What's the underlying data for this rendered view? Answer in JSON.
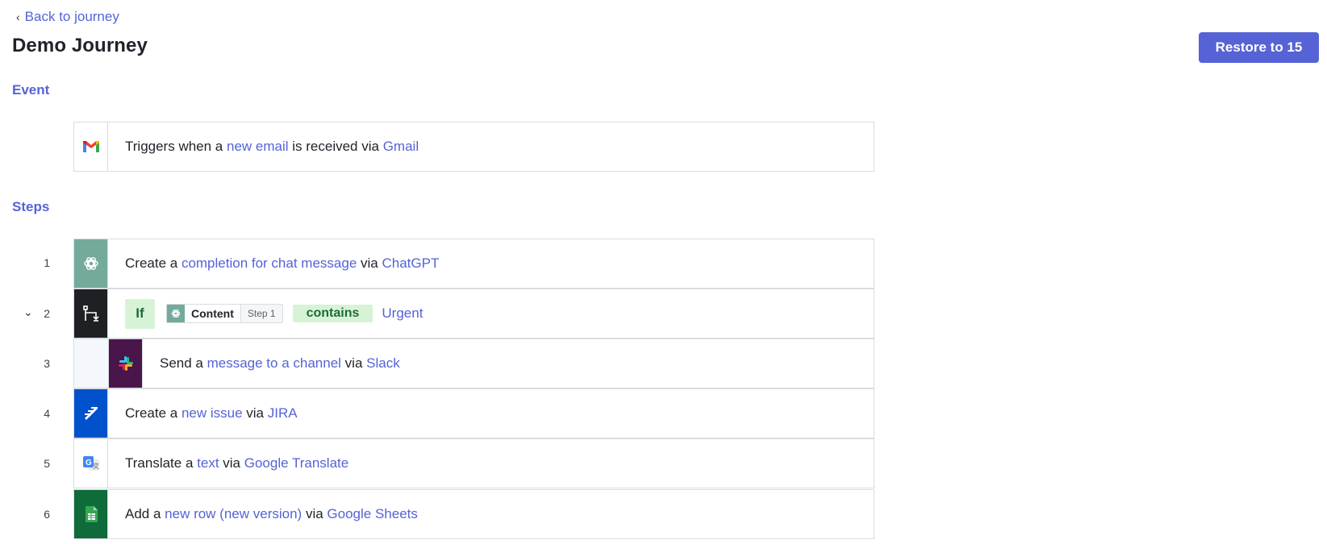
{
  "header": {
    "back_label": "Back to journey",
    "title": "Demo Journey",
    "restore_label": "Restore to 15"
  },
  "sections": {
    "event_label": "Event",
    "steps_label": "Steps"
  },
  "event": {
    "icon": "gmail-icon",
    "prefix": "Triggers when a ",
    "action": "new email",
    "middle": " is received via ",
    "app": "Gmail"
  },
  "steps": [
    {
      "number": "1",
      "icon": "chatgpt-icon",
      "verb": "Create a ",
      "action": "completion for chat message",
      "via": " via ",
      "app": "ChatGPT"
    },
    {
      "number": "2",
      "icon": "branch-icon",
      "if_label": "If",
      "field_label": "Content",
      "field_step": "Step 1",
      "operator": "contains",
      "value": "Urgent"
    },
    {
      "number": "3",
      "icon": "slack-icon",
      "verb": "Send a ",
      "action": "message to a channel",
      "via": " via ",
      "app": "Slack"
    },
    {
      "number": "4",
      "icon": "jira-icon",
      "verb": "Create a ",
      "action": "new issue",
      "via": " via ",
      "app": "JIRA"
    },
    {
      "number": "5",
      "icon": "google-translate-icon",
      "verb": "Translate a ",
      "action": "text",
      "via": " via ",
      "app": "Google Translate"
    },
    {
      "number": "6",
      "icon": "google-sheets-icon",
      "verb": "Add a ",
      "action": "new row (new version)",
      "via": " via ",
      "app": "Google Sheets"
    }
  ],
  "colors": {
    "accent": "#5563d6",
    "chatgpt": "#74aa9c",
    "branch": "#1f2024",
    "slack": "#4a154b",
    "jira": "#0052cc",
    "sheets": "#0f6b3a",
    "condition_bg": "#d7f3d6"
  }
}
